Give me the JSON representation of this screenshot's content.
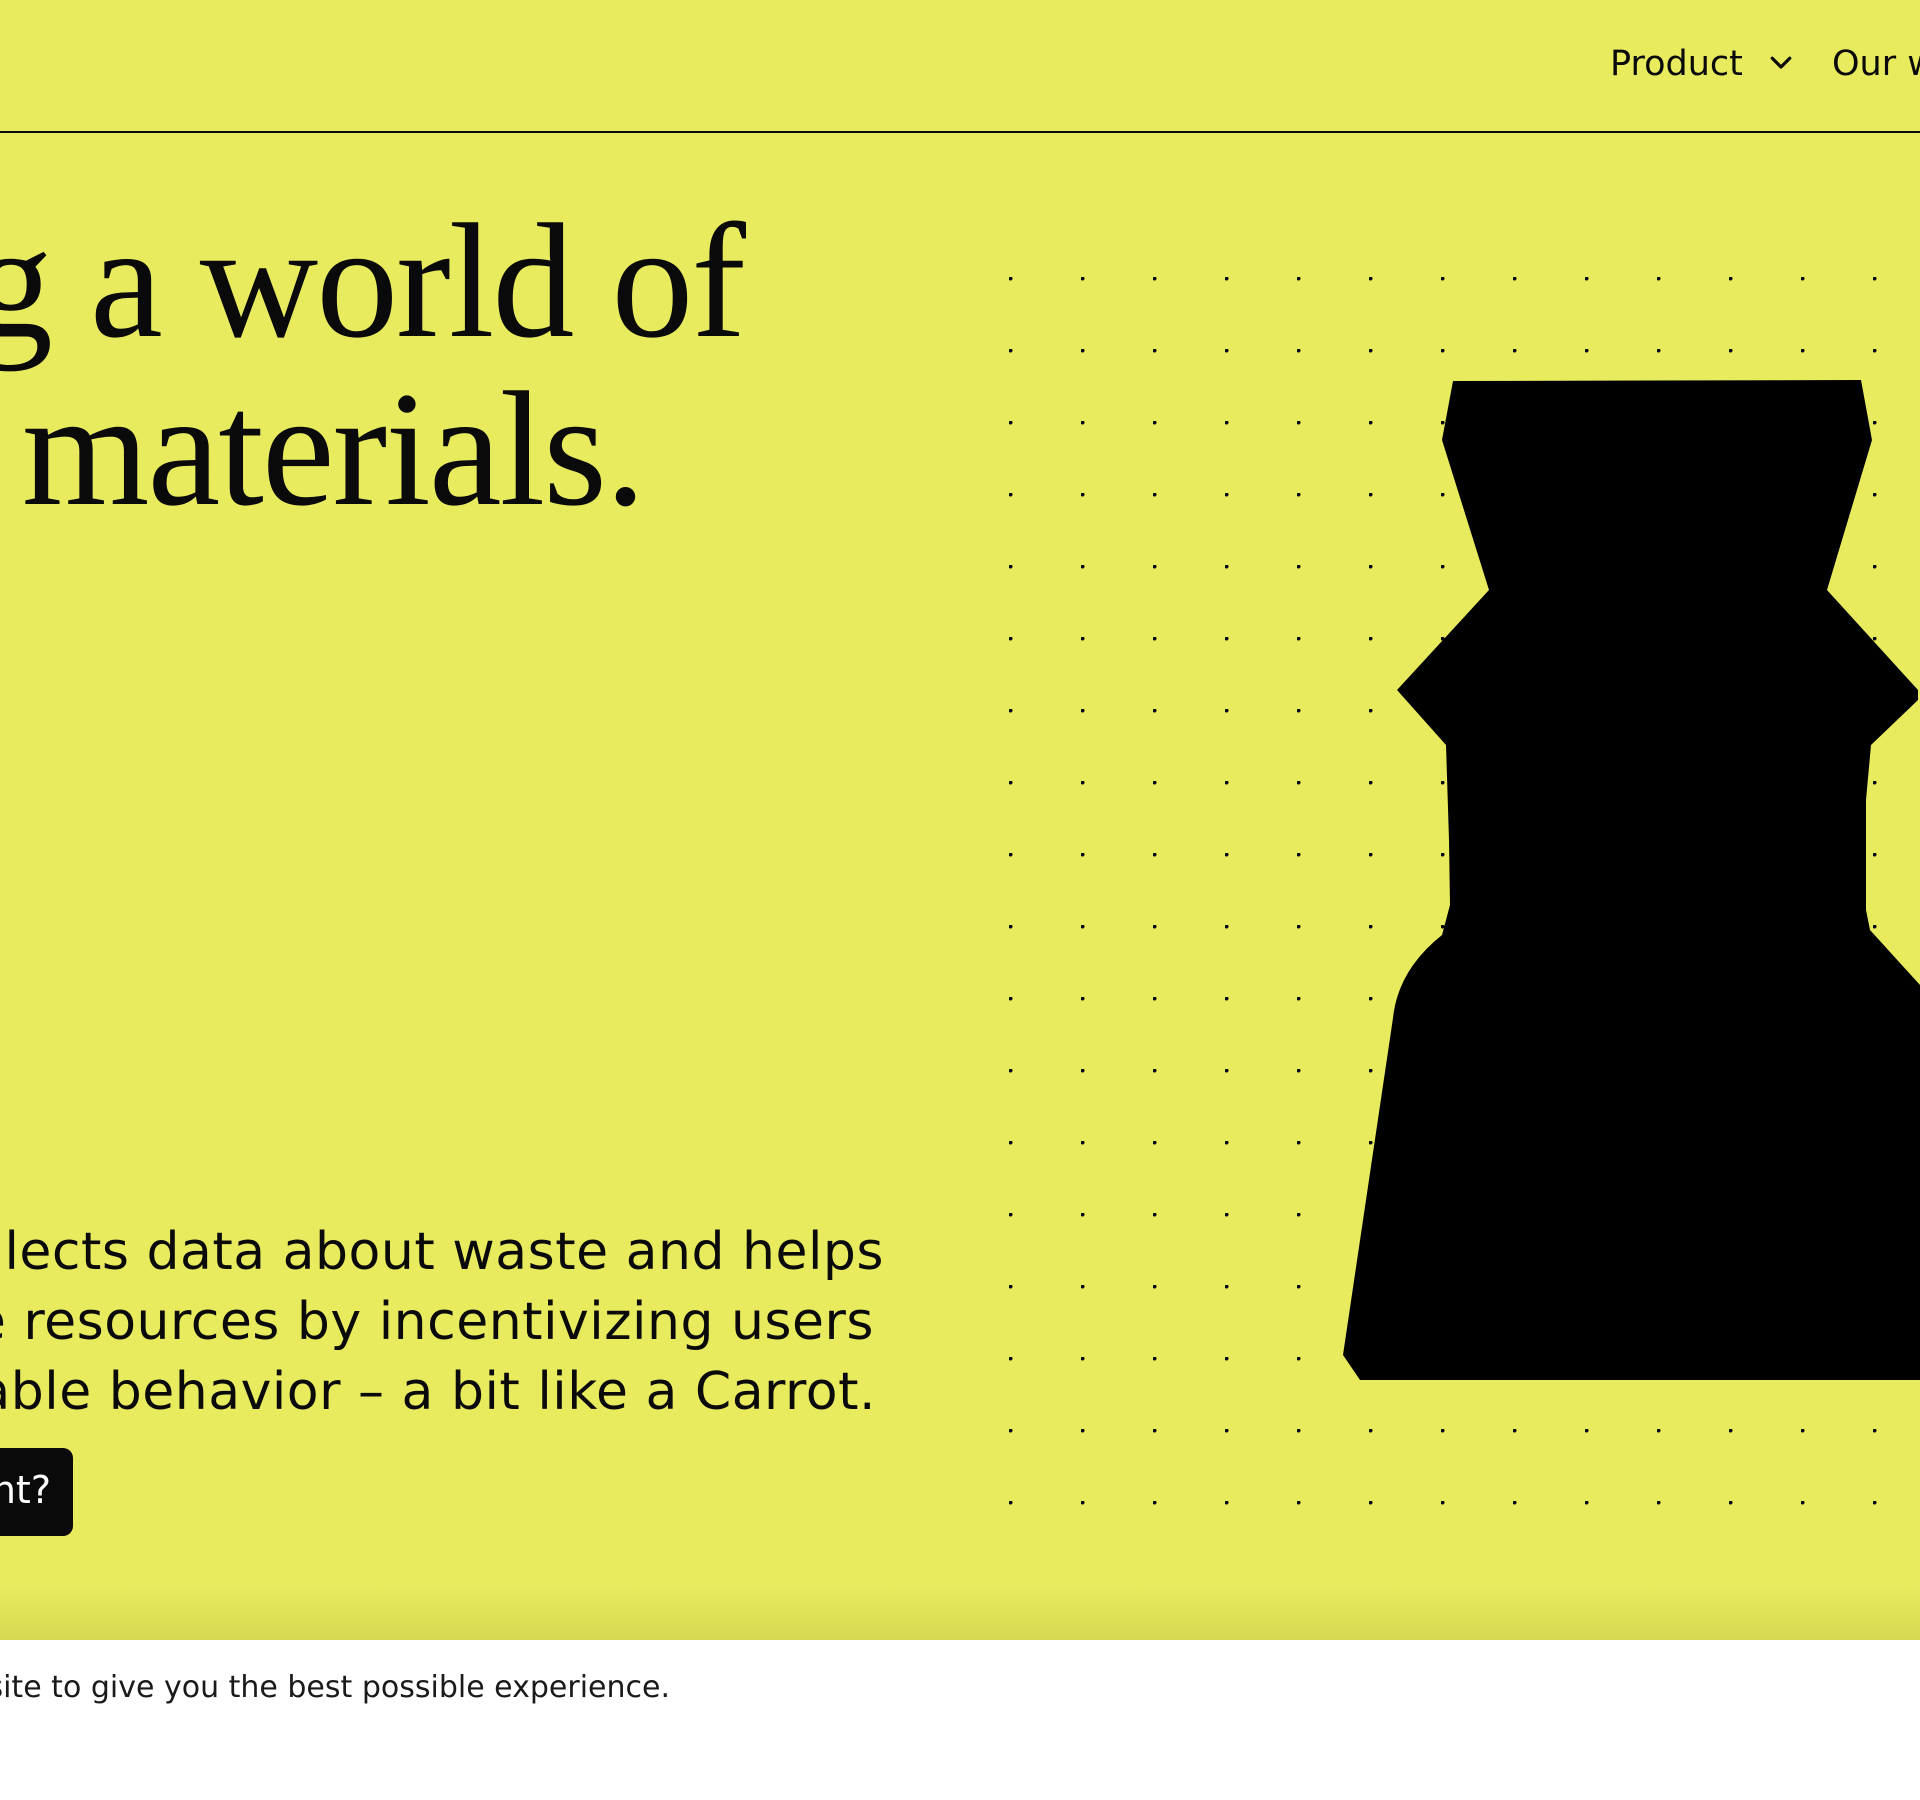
{
  "nav": {
    "product_label": "Product",
    "our_work_label": "Our w"
  },
  "hero": {
    "headline_line1": "ng a world of",
    "headline_line2": "r materials.",
    "description_line1": "ollects data about waste and helps",
    "description_line2": "e resources by incentivizing users",
    "description_line3": "nable behavior – a bit like a Carrot.",
    "cta_label": "nt?",
    "background_color": "#e9eb5f",
    "text_color": "#0a0a0a"
  },
  "cookie_banner": {
    "text": "bsite to give you the best possible experience."
  },
  "icons": {
    "product_dropdown": "chevron-down-icon",
    "illustration": "vessel-silhouette-illustration"
  }
}
